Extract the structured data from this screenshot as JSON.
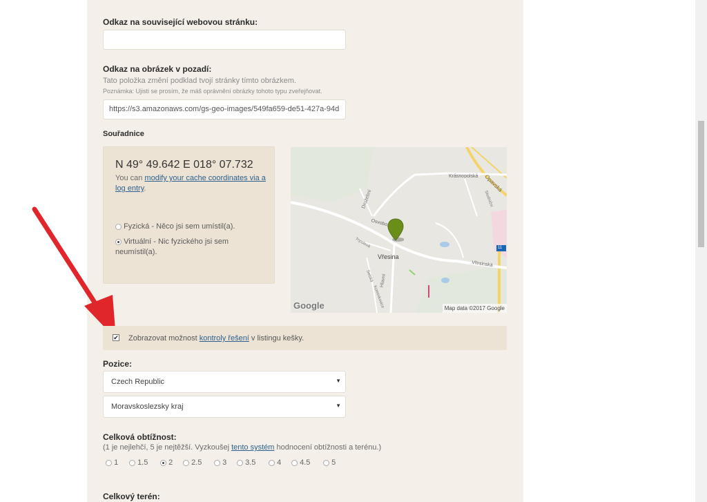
{
  "form": {
    "related_link_label": "Odkaz na související webovou stránku:",
    "related_link_value": "",
    "bg_image_label": "Odkaz na obrázek v pozadí:",
    "bg_image_help": "Tato položka změní podklad tvojí stránky tímto obrázkem.",
    "bg_image_note": "Poznámka: Ujisti se prosím, že máš oprávnění obrázky tohoto typu zveřejňovat.",
    "bg_image_value": "https://s3.amazonaws.com/gs-geo-images/549fa659-de51-427a-94d",
    "coords_label": "Souřadnice",
    "coords_value": "N 49° 49.642 E 018° 07.732",
    "coords_text_prefix": "You can ",
    "coords_link": "modify your cache coordinates via a log entry",
    "coords_text_suffix": ".",
    "radio_physical": "Fyzická - Něco jsi sem umístil(a).",
    "radio_virtual": "Virtuální - Nic fyzického jsi sem neumístil(a).",
    "check_prefix": "Zobrazovat možnost ",
    "check_link": "kontroly řešení",
    "check_suffix": " v listingu kešky.",
    "position_label": "Pozice:",
    "country": "Czech Republic",
    "region": "Moravskoslezsky kraj",
    "difficulty_label": "Celková obtížnost:",
    "difficulty_help_prefix": "(1 je nejlehčí, 5 je nejtěžší. Vyzkoušej ",
    "difficulty_help_link": "tento systém",
    "difficulty_help_suffix": " hodnocení obtížnosti a terénu.)",
    "difficulty_options": [
      "1",
      "1.5",
      "2",
      "2.5",
      "3",
      "3.5",
      "4",
      "4.5",
      "5"
    ],
    "difficulty_selected": "2",
    "terrain_label": "Celkový terén:"
  },
  "map": {
    "google_logo": "Google",
    "attribution": "Map data ©2017 Google",
    "labels": {
      "krasnopolska": "Krásnopolská",
      "opavska": "Opavská",
      "druzebni": "Družební",
      "studnicni": "Studniční",
      "osvobozeni": "Osvobození",
      "topolova": "Topolová",
      "vresina": "Vřesina",
      "vresinska": "Vřesinská",
      "hlavni": "Hlavní",
      "selska": "Selská",
      "kominkovice": "Komínkovice",
      "road_number": "11"
    }
  },
  "colors": {
    "panel_bg": "#f4efe8",
    "box_bg": "#ede3d5",
    "link": "#2a5f8f",
    "marker": "#6b8e1a",
    "arrow": "#e0262b"
  }
}
